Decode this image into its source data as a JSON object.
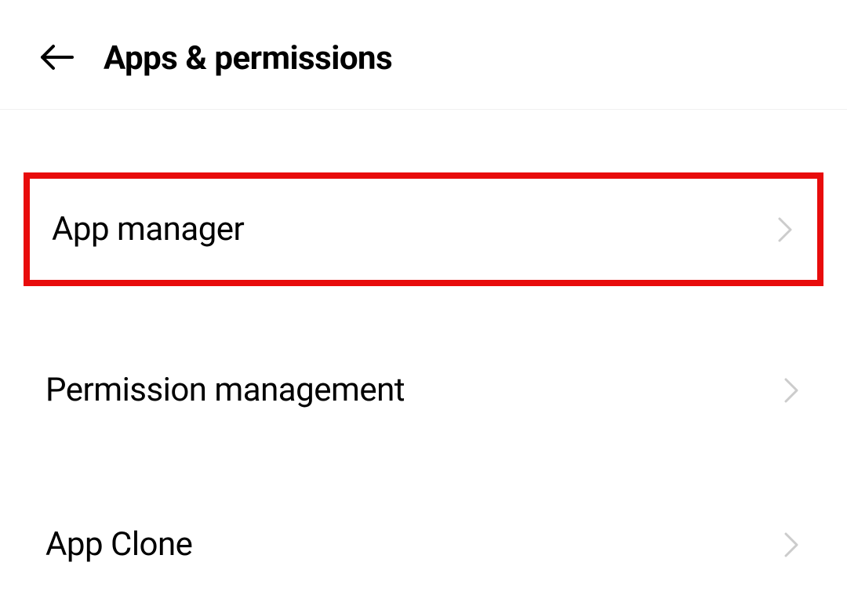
{
  "header": {
    "title": "Apps & permissions"
  },
  "menu": {
    "items": [
      {
        "label": "App manager",
        "highlighted": true
      },
      {
        "label": "Permission management",
        "highlighted": false
      },
      {
        "label": "App Clone",
        "highlighted": false
      }
    ]
  }
}
